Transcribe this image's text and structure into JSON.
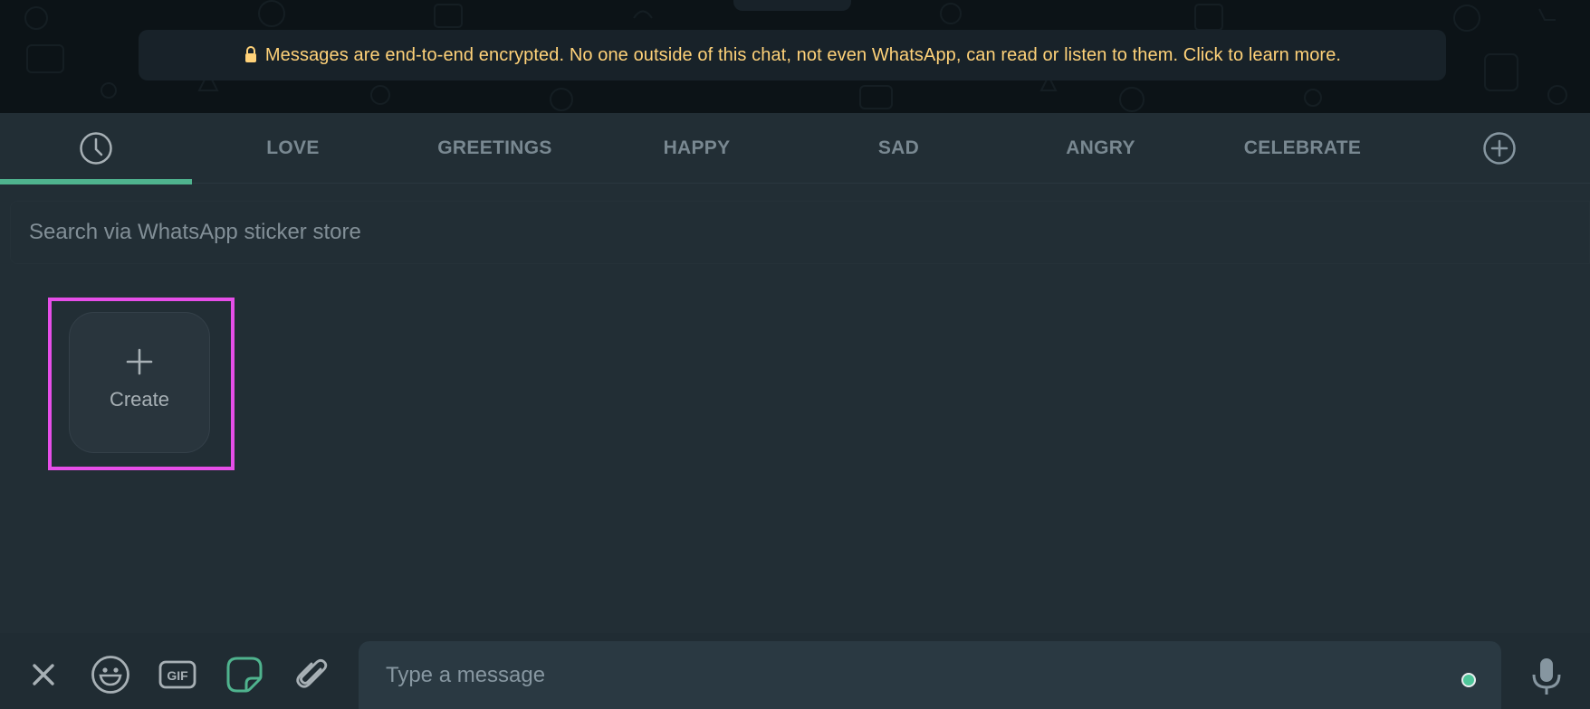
{
  "encryption_banner": {
    "icon": "lock-icon",
    "text": "Messages are end-to-end encrypted. No one outside of this chat, not even WhatsApp, can read or listen to them. Click to learn more."
  },
  "sticker_tabs": {
    "recent_icon": "clock-icon",
    "active_tab": "recent",
    "items": [
      {
        "label": "LOVE"
      },
      {
        "label": "GREETINGS"
      },
      {
        "label": "HAPPY"
      },
      {
        "label": "SAD"
      },
      {
        "label": "ANGRY"
      },
      {
        "label": "CELEBRATE"
      }
    ],
    "add_icon": "plus-circle-icon"
  },
  "search": {
    "placeholder": "Search via WhatsApp sticker store",
    "value": ""
  },
  "stickers": {
    "create_label": "Create",
    "create_icon": "plus-icon"
  },
  "composer": {
    "close_icon": "close-icon",
    "emoji_icon": "emoji-icon",
    "gif_label": "GIF",
    "sticker_icon": "sticker-icon",
    "attach_icon": "paperclip-icon",
    "placeholder": "Type a message",
    "value": "",
    "mic_icon": "microphone-icon"
  },
  "colors": {
    "accent": "#4fb38e",
    "banner_text": "#ffd279",
    "highlight": "#e64ee8"
  }
}
